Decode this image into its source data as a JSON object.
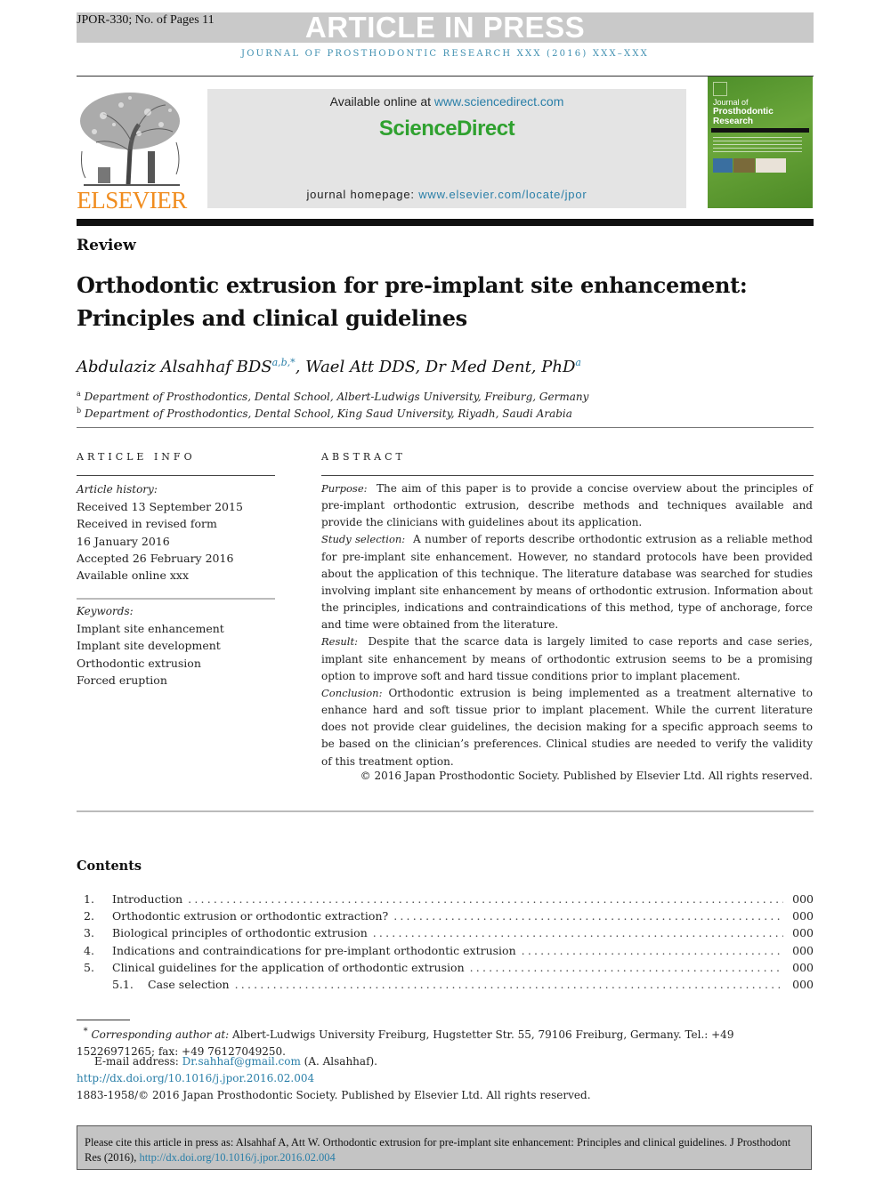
{
  "header": {
    "manuscript_id": "JPOR-330; No. of Pages 11",
    "banner": "ARTICLE IN PRESS",
    "running_head": "JOURNAL OF PROSTHODONTIC RESEARCH XXX (2016) XXX–XXX"
  },
  "masthead": {
    "publisher_logo": "ELSEVIER",
    "available_prefix": "Available online at ",
    "available_url": "www.sciencedirect.com",
    "brand": "ScienceDirect",
    "homepage_prefix": "journal homepage: ",
    "homepage_url": "www.elsevier.com/locate/jpor",
    "cover": {
      "line1": "Journal of",
      "line2": "Prosthodontic",
      "line3": "Research"
    },
    "colors": {
      "link": "#2a7fa8",
      "brand_green": "#2fa12f",
      "elsevier_orange": "#f08c1e"
    }
  },
  "article": {
    "type": "Review",
    "title": "Orthodontic extrusion for pre-implant site enhancement: Principles and clinical guidelines",
    "authors": [
      {
        "name": "Abdulaziz Alsahhaf BDS",
        "marks": "a,b,*"
      },
      {
        "name": "Wael Att DDS, Dr Med Dent, PhD",
        "marks": "a"
      }
    ],
    "author_separator": ", ",
    "affiliations": [
      {
        "mark": "a",
        "text": "Department of Prosthodontics, Dental School, Albert-Ludwigs University, Freiburg, Germany"
      },
      {
        "mark": "b",
        "text": "Department of Prosthodontics, Dental School, King Saud University, Riyadh, Saudi Arabia"
      }
    ]
  },
  "article_info": {
    "heading": "ARTICLE INFO",
    "history_label": "Article history:",
    "history": [
      "Received 13 September 2015",
      "Received in revised form",
      "16 January 2016",
      "Accepted 26 February 2016",
      "Available online xxx"
    ],
    "keywords_label": "Keywords:",
    "keywords": [
      "Implant site enhancement",
      "Implant site development",
      "Orthodontic extrusion",
      "Forced eruption"
    ]
  },
  "abstract": {
    "heading": "ABSTRACT",
    "sections": [
      {
        "label": "Purpose:",
        "text": "The aim of this paper is to provide a concise overview about the principles of pre-implant orthodontic extrusion, describe methods and techniques available and provide the clinicians with guidelines about its application."
      },
      {
        "label": "Study selection:",
        "text": "A number of reports describe orthodontic extrusion as a reliable method for pre-implant site enhancement. However, no standard protocols have been provided about the application of this technique. The literature database was searched for studies involving implant site enhancement by means of orthodontic extrusion. Information about the principles, indications and contraindications of this method, type of anchorage, force and time were obtained from the literature."
      },
      {
        "label": "Result:",
        "text": "Despite that the scarce data is largely limited to case reports and case series, implant site enhancement by means of orthodontic extrusion seems to be a promising option to improve soft and hard tissue conditions prior to implant placement."
      },
      {
        "label": "Conclusion:",
        "text": "Orthodontic extrusion is being implemented as a treatment alternative to enhance hard and soft tissue prior to implant placement. While the current literature does not provide clear guidelines, the decision making for a specific approach seems to be based on the clinician’s preferences. Clinical studies are needed to verify the validity of this treatment option."
      }
    ],
    "copyright": "© 2016 Japan Prosthodontic Society. Published by Elsevier Ltd. All rights reserved."
  },
  "contents": {
    "heading": "Contents",
    "items": [
      {
        "num": "1.",
        "title": "Introduction",
        "page": "000",
        "sub": false
      },
      {
        "num": "2.",
        "title": "Orthodontic extrusion or orthodontic extraction?",
        "page": "000",
        "sub": false
      },
      {
        "num": "3.",
        "title": "Biological principles of orthodontic extrusion",
        "page": "000",
        "sub": false
      },
      {
        "num": "4.",
        "title": "Indications and contraindications for pre-implant orthodontic extrusion",
        "page": "000",
        "sub": false
      },
      {
        "num": "5.",
        "title": "Clinical guidelines for the application of orthodontic extrusion",
        "page": "000",
        "sub": false
      },
      {
        "num": "5.1.",
        "title": "Case selection",
        "page": "000",
        "sub": true
      }
    ]
  },
  "footnotes": {
    "corresponding_mark": "*",
    "corresponding_label": "Corresponding author at:",
    "corresponding_text": "Albert-Ludwigs University Freiburg, Hugstetter Str. 55, 79106 Freiburg, Germany. Tel.: +49 15226971265; fax: +49 76127049250.",
    "email_label": "E-mail address: ",
    "email": "Dr.sahhaf@gmail.com",
    "email_suffix": " (A. Alsahhaf).",
    "doi": "http://dx.doi.org/10.1016/j.jpor.2016.02.004",
    "issn_line": "1883-1958/© 2016 Japan Prosthodontic Society. Published by Elsevier Ltd. All rights reserved."
  },
  "citation": {
    "text": "Please cite this article in press as: Alsahhaf A, Att W. Orthodontic extrusion for pre-implant site enhancement: Principles and clinical guidelines. J Prosthodont Res (2016), ",
    "doi": "http://dx.doi.org/10.1016/j.jpor.2016.02.004"
  }
}
